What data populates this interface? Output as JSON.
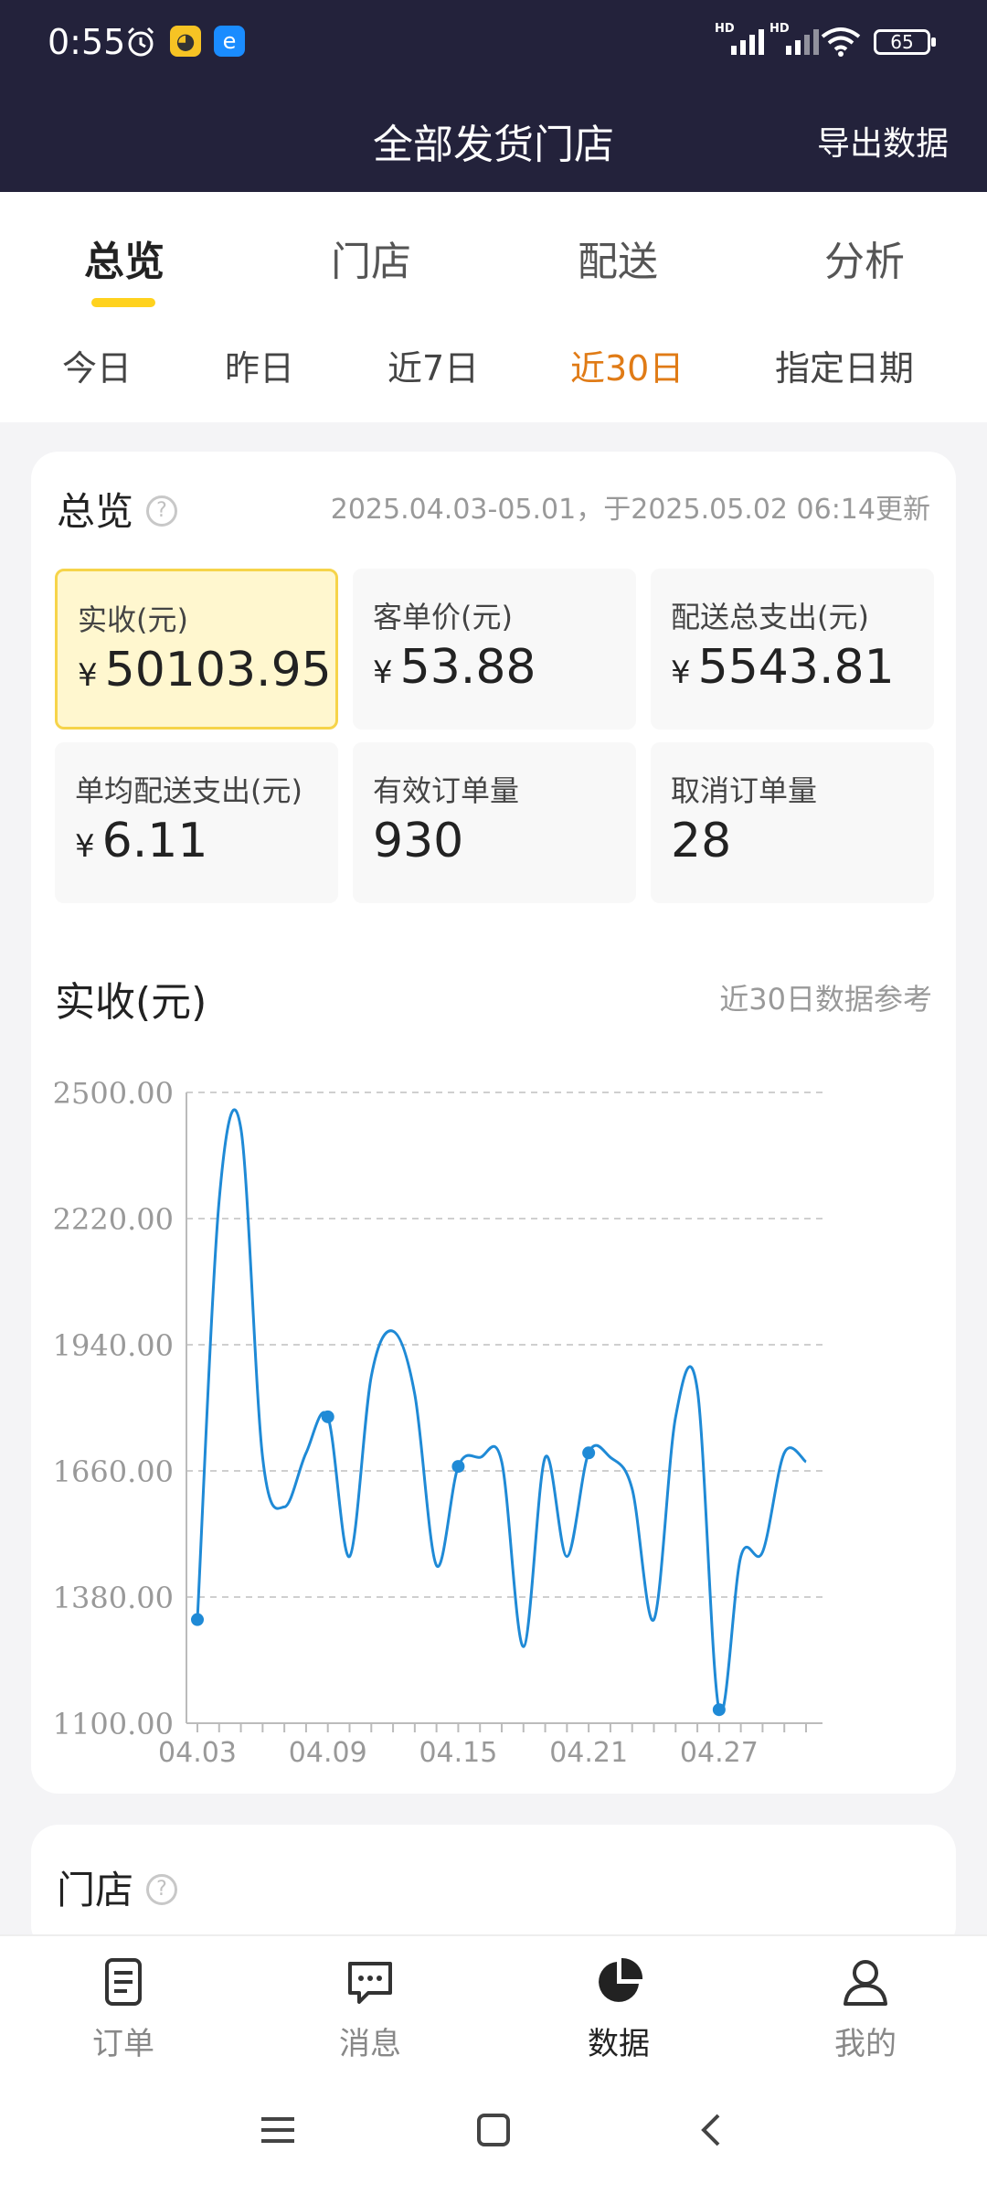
{
  "status_bar": {
    "time": "0:55",
    "battery": "65"
  },
  "header": {
    "title": "全部发货门店",
    "export_label": "导出数据"
  },
  "tabs": [
    {
      "label": "总览",
      "active": true
    },
    {
      "label": "门店",
      "active": false
    },
    {
      "label": "配送",
      "active": false
    },
    {
      "label": "分析",
      "active": false
    }
  ],
  "date_tabs": [
    {
      "label": "今日",
      "active": false
    },
    {
      "label": "昨日",
      "active": false
    },
    {
      "label": "近7日",
      "active": false
    },
    {
      "label": "近30日",
      "active": true
    },
    {
      "label": "指定日期",
      "active": false
    }
  ],
  "overview": {
    "title": "总览",
    "range_text": "2025.04.03-05.01，于2025.05.02 06:14更新",
    "metrics": [
      {
        "label": "实收(元)",
        "currency": "¥",
        "value": "50103.95",
        "highlight": true
      },
      {
        "label": "客单价(元)",
        "currency": "¥",
        "value": "53.88",
        "highlight": false
      },
      {
        "label": "配送总支出(元)",
        "currency": "¥",
        "value": "5543.81",
        "highlight": false
      },
      {
        "label": "单均配送支出(元)",
        "currency": "¥",
        "value": "6.11",
        "highlight": false
      },
      {
        "label": "有效订单量",
        "currency": "",
        "value": "930",
        "highlight": false
      },
      {
        "label": "取消订单量",
        "currency": "",
        "value": "28",
        "highlight": false
      }
    ]
  },
  "chart_section": {
    "title": "实收(元)",
    "note": "近30日数据参考"
  },
  "chart_data": {
    "type": "line",
    "title": "实收(元)",
    "x": [
      "04.03",
      "04.04",
      "04.05",
      "04.06",
      "04.07",
      "04.08",
      "04.09",
      "04.10",
      "04.11",
      "04.12",
      "04.13",
      "04.14",
      "04.15",
      "04.16",
      "04.17",
      "04.18",
      "04.19",
      "04.20",
      "04.21",
      "04.22",
      "04.23",
      "04.24",
      "04.25",
      "04.26",
      "04.27",
      "04.28",
      "04.29",
      "04.30",
      "05.01"
    ],
    "x_tick_labels": [
      "04.03",
      "04.09",
      "04.15",
      "04.21",
      "04.27"
    ],
    "values": [
      1330,
      2260,
      2420,
      1690,
      1580,
      1700,
      1780,
      1470,
      1870,
      1970,
      1830,
      1450,
      1670,
      1690,
      1680,
      1270,
      1690,
      1470,
      1700,
      1690,
      1620,
      1330,
      1780,
      1840,
      1130,
      1470,
      1480,
      1700,
      1680
    ],
    "markers": [
      0,
      6,
      12,
      18,
      24
    ],
    "y_ticks": [
      "2500.00",
      "2220.00",
      "1940.00",
      "1660.00",
      "1380.00",
      "1100.00"
    ],
    "ylim": [
      1100,
      2500
    ],
    "grid": true,
    "color": "#1f8ad6"
  },
  "stores_section": {
    "title": "门店"
  },
  "bottom_nav": [
    {
      "label": "订单",
      "icon": "order-icon",
      "active": false
    },
    {
      "label": "消息",
      "icon": "message-icon",
      "active": false
    },
    {
      "label": "数据",
      "icon": "data-pie-icon",
      "active": true
    },
    {
      "label": "我的",
      "icon": "profile-icon",
      "active": false
    }
  ]
}
